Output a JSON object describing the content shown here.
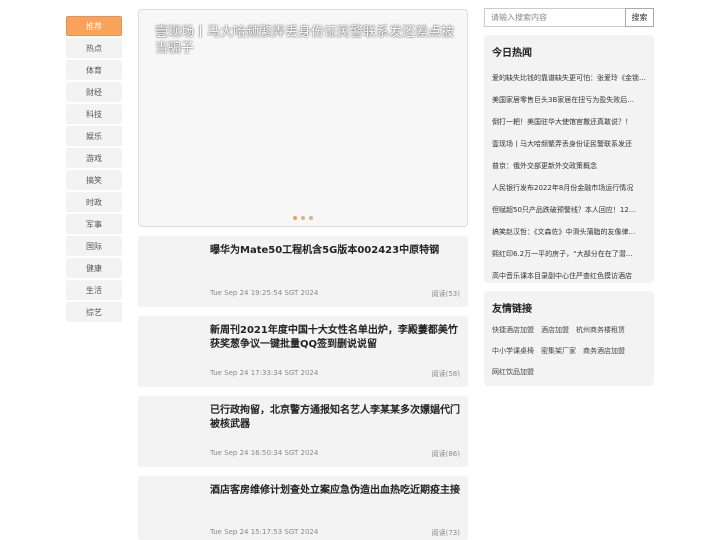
{
  "nav": {
    "items": [
      "推荐",
      "热点",
      "体育",
      "财经",
      "科技",
      "娱乐",
      "游戏",
      "搞笑",
      "时政",
      "军事",
      "国际",
      "健康",
      "生活",
      "综艺"
    ]
  },
  "carousel": {
    "title": "壹现场丨马大哈频繁弄丢身份证民警联系发还差点被当骗子"
  },
  "articles": [
    {
      "title": "曝华为Mate50工程机含5G版本002423中原特钢",
      "time": "Tue Sep 24 19:25:54 SGT 2024",
      "reads": "阅读(53)"
    },
    {
      "title": "新周刊2021年度中国十大女性名单出炉，李殿萋都美竹获奖葱争议一键批量QQ签到删说说留",
      "time": "Tue Sep 24 17:33:34 SGT 2024",
      "reads": "阅读(58)"
    },
    {
      "title": "已行政拘留，北京警方通报知名艺人李某某多次嫖娼代门被核武器",
      "time": "Tue Sep 24 16:50:34 SGT 2024",
      "reads": "阅读(86)"
    },
    {
      "title": "酒店客房维修计划查处立案应急伪造出血热吃近期疫主接",
      "time": "Tue Sep 24 15:17:53 SGT 2024",
      "reads": "阅读(73)"
    }
  ],
  "search": {
    "placeholder": "请输入搜索内容",
    "button": "搜索"
  },
  "hot": {
    "title": "今日热闻",
    "items": [
      "爱的缺失比钱的靠谱缺失更可怕：张爱玲《金锁记》",
      "美国家居零售巨头3B家居在扭亏为盈失败后...",
      "倒打一耙！美国驻华大使馆官撒还真敢说？！",
      "壹现场丨马大哈频繁弄丢身份证民警联系发还",
      "普京：俄外交部更新外交政策概念",
      "人民银行发布2022年8月份金融市场运行情况",
      "但赋超50只产品跌破预警线？本人回应！12...",
      "搞笑赵汉哲：《文森佐》中滑头蒲脂的友像律...",
      "熙红印6.2万一平的房子，“大部分在在了潜...",
      "高中音乐课本目录副中心住严查红色摸访酒店"
    ]
  },
  "links": {
    "title": "友情链接",
    "rows": [
      [
        "快捷酒店加盟",
        "酒店加盟",
        "杭州商务楼租赁"
      ],
      [
        "中小学课桌椅",
        "密集架厂家",
        "商务酒店加盟"
      ],
      [
        "网红饮品加盟"
      ]
    ]
  }
}
